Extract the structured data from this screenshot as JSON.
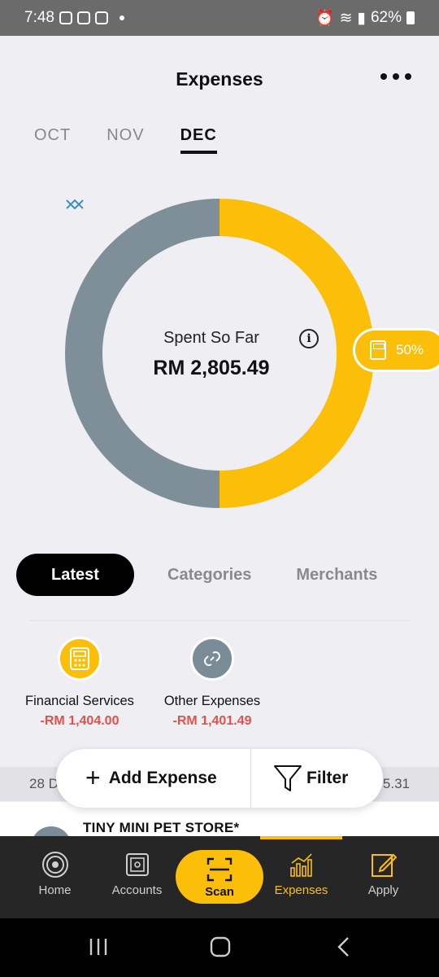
{
  "status_bar": {
    "time": "7:48",
    "battery": "62%"
  },
  "header": {
    "title": "Expenses"
  },
  "months": [
    {
      "label": "OCT"
    },
    {
      "label": "NOV"
    },
    {
      "label": "DEC"
    }
  ],
  "summary": {
    "label": "Spent So Far",
    "amount": "RM 2,805.49",
    "budget_percent_label": "50%",
    "budget_percent": 0.5,
    "colors": {
      "spent": "#fbbf0a",
      "remaining": "#7f8f99"
    }
  },
  "tabs": [
    {
      "label": "Latest"
    },
    {
      "label": "Categories"
    },
    {
      "label": "Merchants"
    }
  ],
  "categories": [
    {
      "name": "Financial Services",
      "amount": "-RM 1,404.00",
      "icon": "calculator-icon",
      "color": "#fbbf0a"
    },
    {
      "name": "Other Expenses",
      "amount": "-RM 1,401.49",
      "icon": "link-icon",
      "color": "#7a8c98"
    }
  ],
  "transactions": {
    "date_left": "28 D",
    "amount_right": "5.31",
    "items": [
      {
        "merchant": "TINY MINI PET STORE*"
      }
    ]
  },
  "actions": {
    "add_label": "Add Expense",
    "filter_label": "Filter"
  },
  "bottom_nav": [
    {
      "label": "Home",
      "icon": "home-icon"
    },
    {
      "label": "Accounts",
      "icon": "safe-icon"
    },
    {
      "label": "Scan",
      "icon": "scan-icon"
    },
    {
      "label": "Expenses",
      "icon": "chart-icon"
    },
    {
      "label": "Apply",
      "icon": "edit-icon"
    }
  ]
}
